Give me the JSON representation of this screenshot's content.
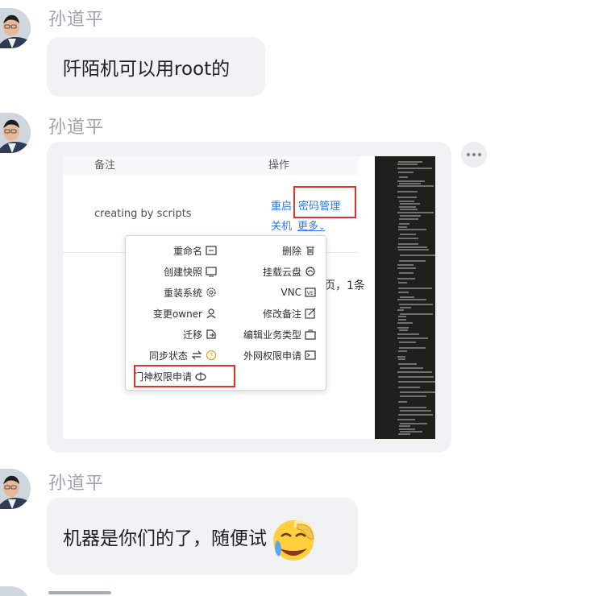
{
  "messages": [
    {
      "sender": "孙道平",
      "text": "阡陌机可以用root的"
    },
    {
      "sender": "孙道平",
      "type": "screenshot"
    },
    {
      "sender": "孙道平",
      "text": "机器是你们的了，随便试"
    }
  ],
  "screenshot": {
    "header": {
      "col_remark": "备注",
      "col_action": "操作"
    },
    "row": {
      "remark": "creating by scripts",
      "restart": "重启",
      "password_mgmt": "密码管理",
      "shutdown": "关机",
      "more": "更多"
    },
    "pagination_partial": "页，1条",
    "menu": {
      "left": [
        {
          "label": "重命名",
          "icon": "rename-icon"
        },
        {
          "label": "创建快照",
          "icon": "snapshot-icon"
        },
        {
          "label": "重装系统",
          "icon": "gear-icon"
        },
        {
          "label": "变更owner",
          "icon": "user-icon"
        },
        {
          "label": "迁移",
          "icon": "migrate-icon"
        },
        {
          "label": "同步状态",
          "icon": "sync-icon"
        },
        {
          "label": "门神权限申请",
          "icon": "guard-icon"
        }
      ],
      "right": [
        {
          "label": "删除",
          "icon": "trash-icon"
        },
        {
          "label": "挂载云盘",
          "icon": "cloud-disk-icon"
        },
        {
          "label": "VNC",
          "icon": "vnc-icon"
        },
        {
          "label": "修改备注",
          "icon": "edit-icon"
        },
        {
          "label": "编辑业务类型",
          "icon": "briefcase-icon"
        },
        {
          "label": "外网权限申请",
          "icon": "terminal-icon"
        }
      ],
      "help_icon": "question-icon"
    }
  },
  "colors": {
    "link": "#2f7ae5",
    "highlight": "#e0322b",
    "bubble": "#f1f2f4",
    "sender": "#9ea3ab"
  }
}
